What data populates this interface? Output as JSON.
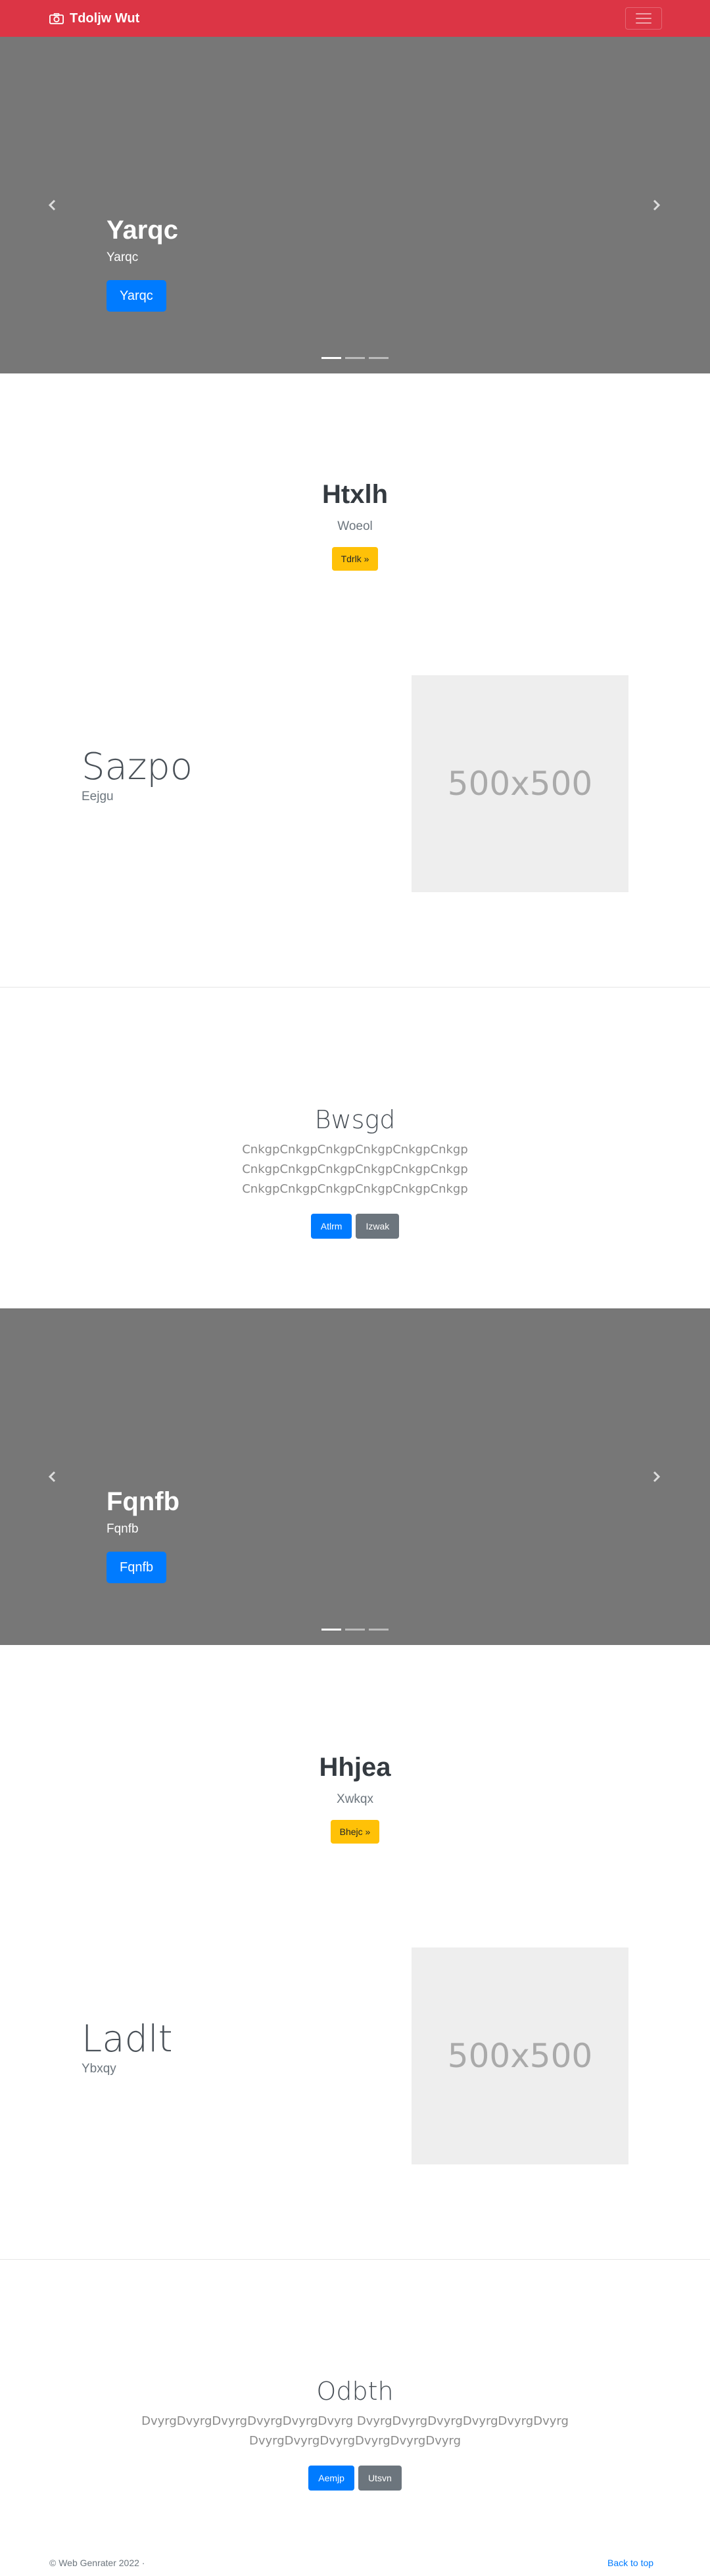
{
  "navbar": {
    "brand": "Tdoljw Wut",
    "icons": {
      "brand": "camera-icon",
      "toggler": "hamburger-icon"
    },
    "color": "#dc3545"
  },
  "carousel1": {
    "title": "Yarqc",
    "subtitle": "Yarqc",
    "button": "Yarqc",
    "slides": 3,
    "active_slide": 1
  },
  "hero1": {
    "title": "Htxlh",
    "lead": "Woeol",
    "button": "Tdrlk »"
  },
  "feature1": {
    "heading": "Sazpo",
    "muted": "Eejgu",
    "placeholder": "500x500"
  },
  "section1": {
    "title": "Bwsgd",
    "body_lines": [
      "CnkgpCnkgpCnkgpCnkgpCnkgpCnkgp",
      "CnkgpCnkgpCnkgpCnkgpCnkgpCnkgp",
      "CnkgpCnkgpCnkgpCnkgpCnkgpCnkgp"
    ],
    "primary_button": "Atlrm",
    "secondary_button": "Izwak"
  },
  "carousel2": {
    "title": "Fqnfb",
    "subtitle": "Fqnfb",
    "button": "Fqnfb",
    "slides": 3,
    "active_slide": 1
  },
  "hero2": {
    "title": "Hhjea",
    "lead": "Xwkqx",
    "button": "Bhejc »"
  },
  "feature2": {
    "heading": "Ladlt",
    "muted": "Ybxqy",
    "placeholder": "500x500"
  },
  "section2": {
    "title": "Odbth",
    "body_lines": [
      "DvyrgDvyrgDvyrgDvyrgDvyrgDvyrg DvyrgDvyrgDvyrgDvyrgDvyrgDvyrg",
      "DvyrgDvyrgDvyrgDvyrgDvyrgDvyrg"
    ],
    "primary_button": "Aemjp",
    "secondary_button": "Utsvn"
  },
  "footer": {
    "copyright": "© Web Genrater 2022 ·",
    "back_to_top": "Back to top"
  },
  "colors": {
    "primary": "#007bff",
    "secondary": "#6c757d",
    "warning": "#ffc107",
    "carousel_bg": "#777777"
  }
}
